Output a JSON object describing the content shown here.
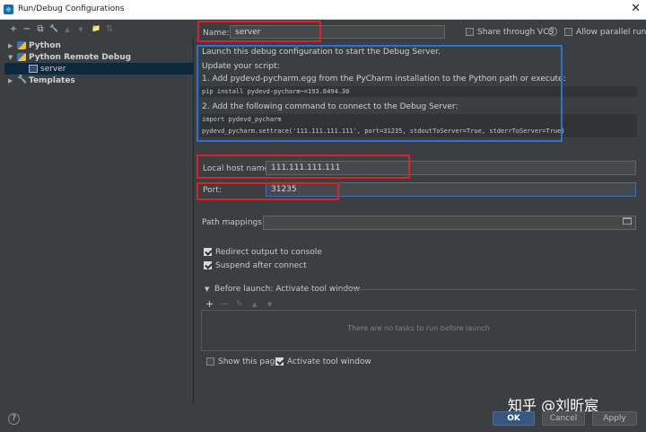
{
  "window": {
    "title": "Run/Debug Configurations",
    "close": "✕"
  },
  "toolbar": {
    "add": "+",
    "remove": "−",
    "copy": "⧉",
    "edit": "🔧",
    "up": "▲",
    "down": "▼",
    "folder": "📁",
    "sort": "⇅"
  },
  "tree": {
    "items": [
      {
        "label": "Python",
        "arrow": "▶"
      },
      {
        "label": "Python Remote Debug",
        "arrow": "▼"
      },
      {
        "label": "server"
      },
      {
        "label": "Templates",
        "arrow": "▶"
      }
    ]
  },
  "form": {
    "name_label": "Name:",
    "name_value": "server",
    "share_label": "Share through VCS",
    "share_help": "?",
    "parallel_label": "Allow parallel run",
    "info": {
      "line1": "Launch this debug configuration to start the Debug Server.",
      "line2": "Update your script:",
      "line3": "1. Add pydevd-pycharm.egg from the PyCharm installation to the Python path or execute:",
      "code1": "pip install pydevd-pycharm~=193.6494.30",
      "line4": "2. Add the following command to connect to the Debug Server:",
      "code2": "import pydevd_pycharm",
      "code3": "pydevd_pycharm.settrace('111.111.111.111', port=31235, stdoutToServer=True, stderrToServer=True)"
    },
    "host_label": "Local host name:",
    "host_value": "111.111.111.111",
    "port_label": "Port:",
    "port_value": "31235",
    "mappings_label": "Path mappings:",
    "mappings_value": "",
    "redirect_label": "Redirect output to console",
    "suspend_label": "Suspend after connect",
    "before_launch_label": "Before launch: Activate tool window",
    "before_launch_arrow": "▼",
    "task_add": "+",
    "task_remove": "−",
    "task_edit": "✎",
    "task_up": "▲",
    "task_down": "▼",
    "empty_tasks": "There are no tasks to run before launch",
    "show_page_label": "Show this page",
    "activate_label": "Activate tool window"
  },
  "buttons": {
    "ok": "OK",
    "cancel": "Cancel",
    "apply": "Apply",
    "help": "?"
  },
  "watermark": "知乎 @刘昕宸",
  "colors": {
    "highlight_red": "#d8232a",
    "highlight_blue": "#2f70d1",
    "primary_button": "#365880"
  }
}
